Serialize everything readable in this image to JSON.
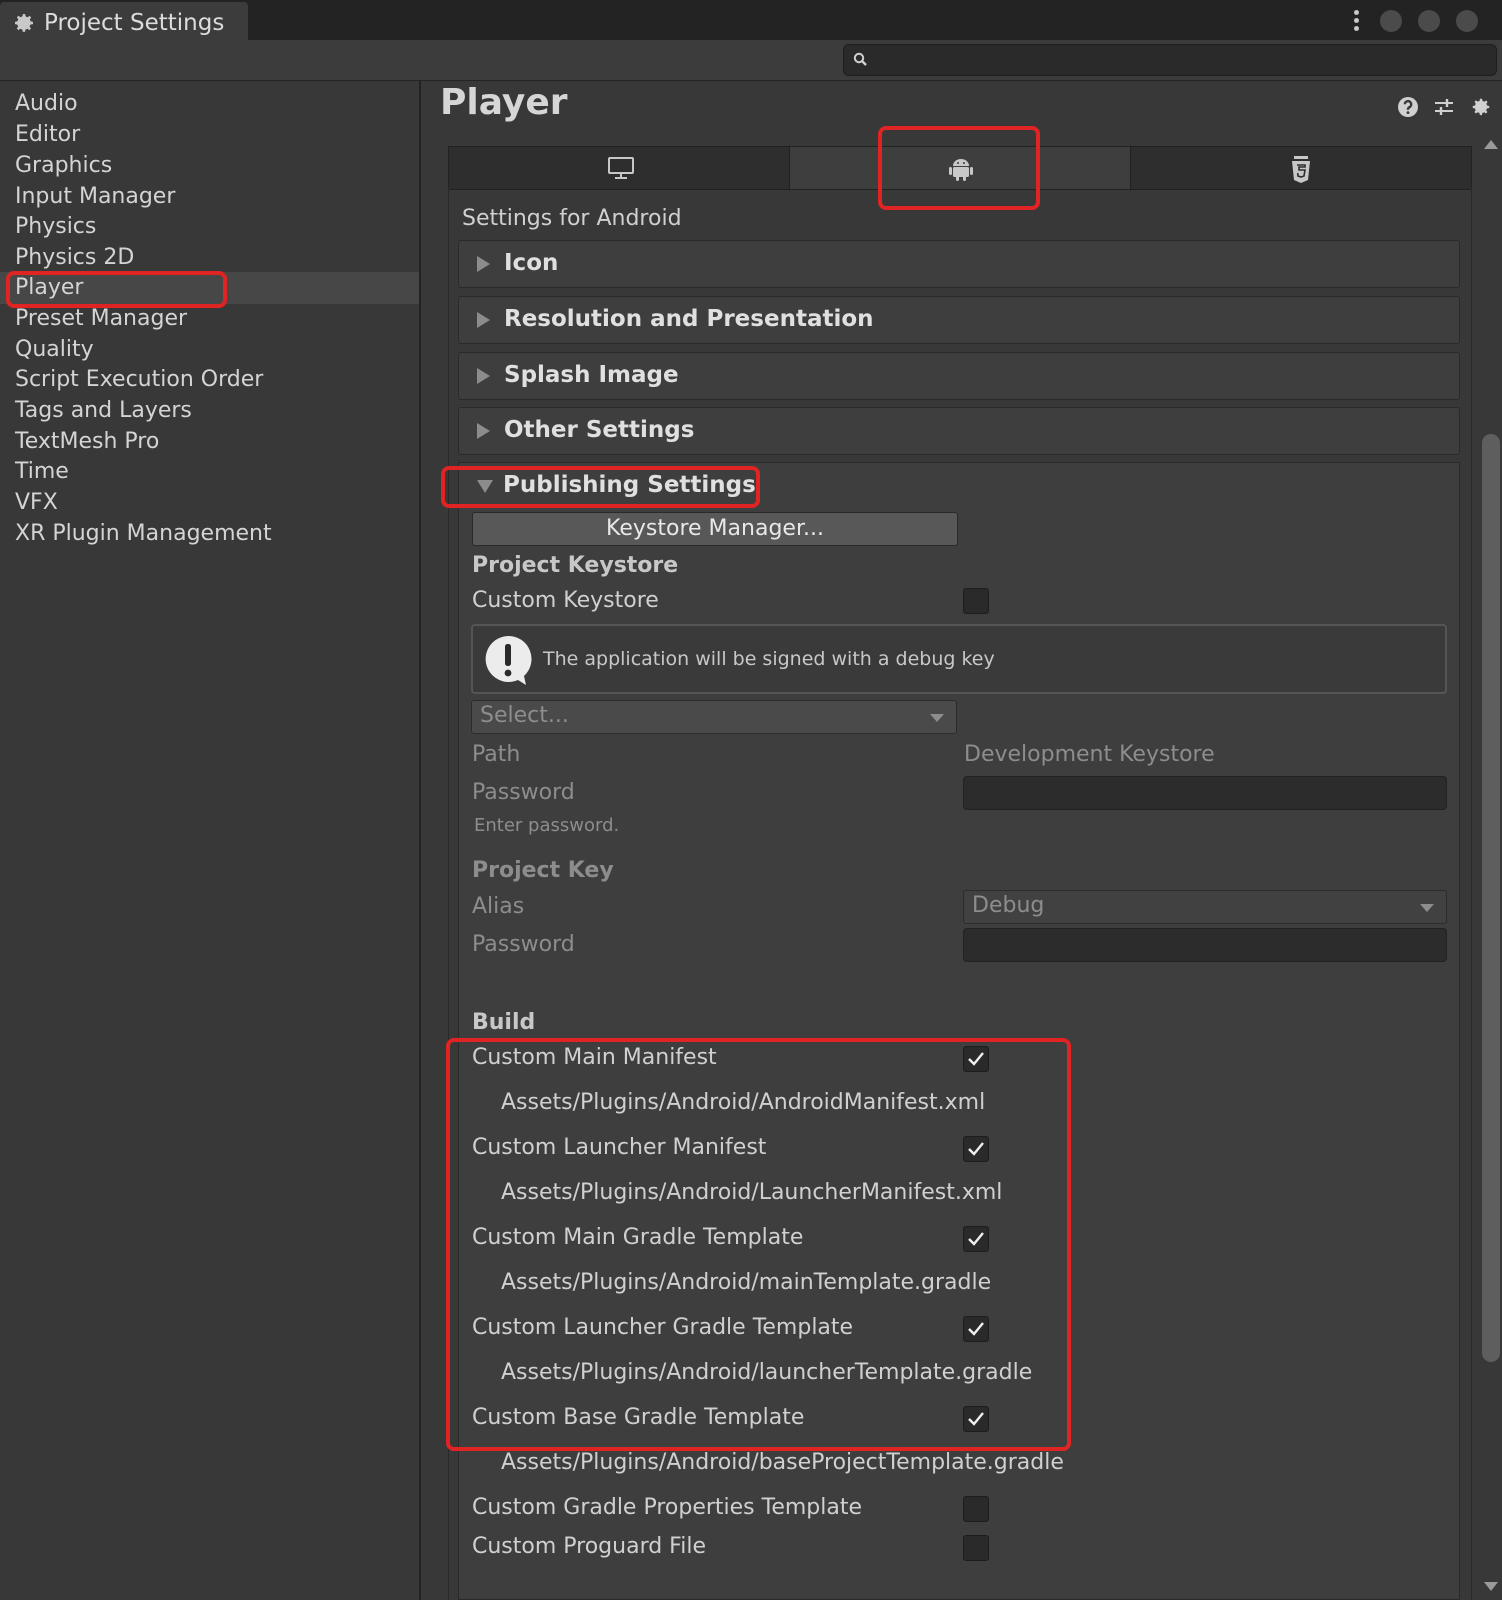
{
  "window": {
    "tab_title": "Project Settings"
  },
  "search": {
    "placeholder": ""
  },
  "sidebar": {
    "items": [
      {
        "label": "Audio"
      },
      {
        "label": "Editor"
      },
      {
        "label": "Graphics"
      },
      {
        "label": "Input Manager"
      },
      {
        "label": "Physics"
      },
      {
        "label": "Physics 2D"
      },
      {
        "label": "Player"
      },
      {
        "label": "Preset Manager"
      },
      {
        "label": "Quality"
      },
      {
        "label": "Script Execution Order"
      },
      {
        "label": "Tags and Layers"
      },
      {
        "label": "TextMesh Pro"
      },
      {
        "label": "Time"
      },
      {
        "label": "VFX"
      },
      {
        "label": "XR Plugin Management"
      }
    ],
    "selected": "Player"
  },
  "main": {
    "title": "Player",
    "header_icons": [
      "help-icon",
      "preset-sliders-icon",
      "gear-icon"
    ],
    "platform_tabs": [
      {
        "icon": "desktop-icon",
        "selected": false
      },
      {
        "icon": "android-icon",
        "selected": true
      },
      {
        "icon": "html5-icon",
        "selected": false
      }
    ],
    "settings_for": "Settings for Android",
    "sections": {
      "icon": "Icon",
      "resolution": "Resolution and Presentation",
      "splash": "Splash Image",
      "other": "Other Settings",
      "publishing": "Publishing Settings"
    },
    "publishing": {
      "keystore_manager_button": "Keystore Manager...",
      "project_keystore_heading": "Project Keystore",
      "custom_keystore_label": "Custom Keystore",
      "custom_keystore_checked": false,
      "help_message": "The application will be signed with a debug key",
      "keystore_select": "Select...",
      "path_label": "Path",
      "path_value": "Development Keystore",
      "password_label": "Password",
      "password_hint": "Enter password.",
      "project_key_heading": "Project Key",
      "alias_label": "Alias",
      "alias_value": "Debug",
      "key_password_label": "Password",
      "build_heading": "Build",
      "build_items": [
        {
          "label": "Custom Main Manifest",
          "checked": true,
          "path": "Assets/Plugins/Android/AndroidManifest.xml"
        },
        {
          "label": "Custom Launcher Manifest",
          "checked": true,
          "path": "Assets/Plugins/Android/LauncherManifest.xml"
        },
        {
          "label": "Custom Main Gradle Template",
          "checked": true,
          "path": "Assets/Plugins/Android/mainTemplate.gradle"
        },
        {
          "label": "Custom Launcher Gradle Template",
          "checked": true,
          "path": "Assets/Plugins/Android/launcherTemplate.gradle"
        },
        {
          "label": "Custom Base Gradle Template",
          "checked": true,
          "path": "Assets/Plugins/Android/baseProjectTemplate.gradle"
        },
        {
          "label": "Custom Gradle Properties Template",
          "checked": false,
          "path": ""
        },
        {
          "label": "Custom Proguard File",
          "checked": false,
          "path": ""
        }
      ]
    }
  },
  "colors": {
    "highlight_red": "#e02424",
    "background": "#383838",
    "panel": "#3e3e3e"
  }
}
